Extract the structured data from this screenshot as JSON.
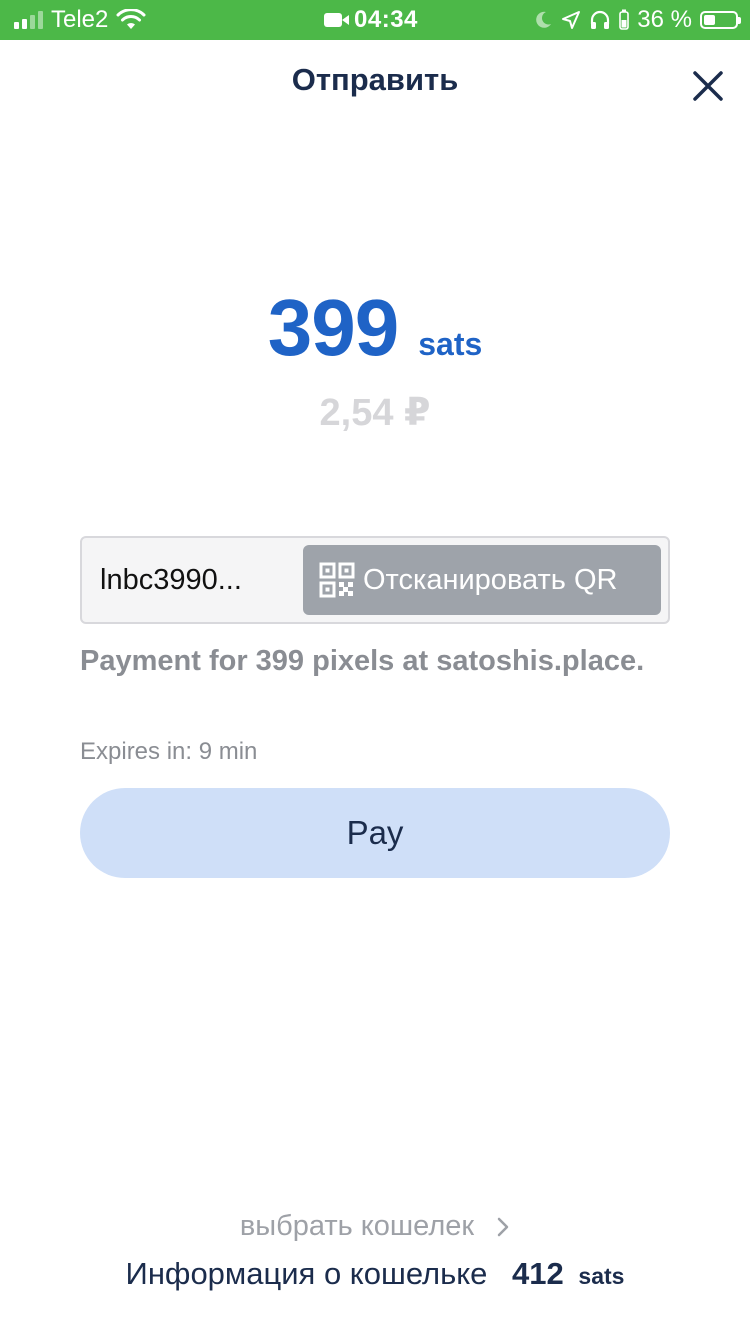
{
  "status_bar": {
    "carrier": "Tele2",
    "time": "04:34",
    "battery_percent": "36 %",
    "battery_level": 0.36,
    "icons": [
      "signal-icon",
      "wifi-icon",
      "camera-icon",
      "moon-icon",
      "location-icon",
      "headphones-icon",
      "battery-icon"
    ]
  },
  "header": {
    "title": "Отправить",
    "close_icon": "close-icon"
  },
  "amount": {
    "value": "399",
    "unit": "sats",
    "fiat": "2,54 ₽"
  },
  "invoice": {
    "value": "lnbc3990...",
    "scan_label": "Отсканировать QR",
    "scan_icon": "qr-code-icon"
  },
  "description": "Payment for 399 pixels at satoshis.place.",
  "expires": "Expires in: 9 min",
  "pay_label": "Pay",
  "footer": {
    "choose_wallet": "выбрать кошелек",
    "wallet_info_label": "Информация о кошельке",
    "balance_value": "412",
    "balance_unit": "sats"
  },
  "colors": {
    "status_bar": "#4cb848",
    "primary": "#1f63c6",
    "dark_text": "#1b2c4c",
    "pay_button_bg": "#cfdff8",
    "scan_button_bg": "#9ea3aa"
  }
}
